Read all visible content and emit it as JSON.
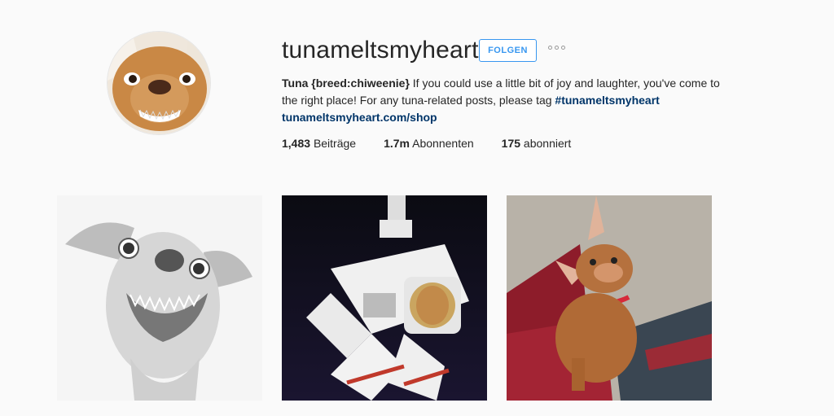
{
  "profile": {
    "username": "tunameltsmyheart",
    "follow_label": "FOLGEN",
    "bio_name": "Tuna {breed:chiweenie}",
    "bio_text": " If you could use a little bit of joy and laughter, you've come to the right place! For any tuna-related posts, please tag ",
    "bio_hashtag": "#tunameltsmyheart",
    "bio_link": "tunameltsmyheart.com/shop"
  },
  "stats": {
    "posts_count": "1,483",
    "posts_label": "Beiträge",
    "followers_count": "1.7m",
    "followers_label": "Abonnenten",
    "following_count": "175",
    "following_label": "abonniert"
  },
  "icons": {
    "options": "more-options-icon"
  },
  "colors": {
    "accent": "#3897f0",
    "link": "#003569",
    "background": "#fafafa"
  }
}
